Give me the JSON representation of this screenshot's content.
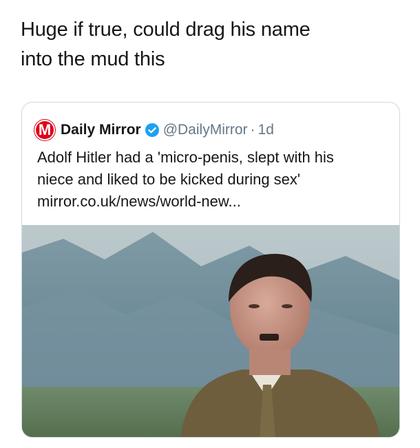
{
  "tweet": {
    "text_line1": "Huge if true, could drag his name",
    "text_line2": "into the mud this"
  },
  "quoted_tweet": {
    "logo_letter": "M",
    "display_name": "Daily Mirror",
    "handle": "@DailyMirror",
    "separator": "·",
    "time": "1d",
    "text_line1": "Adolf Hitler had a 'micro-penis, slept with his",
    "text_line2": "niece and liked to be kicked during sex'",
    "link": "mirror.co.uk/news/world-new..."
  },
  "icons": {
    "verified": "verified-badge-icon",
    "logo": "daily-mirror-logo"
  },
  "colors": {
    "brand_red": "#e1001a",
    "verified_blue": "#1da1f2",
    "secondary_text": "#657786",
    "border": "#cfd9de"
  }
}
